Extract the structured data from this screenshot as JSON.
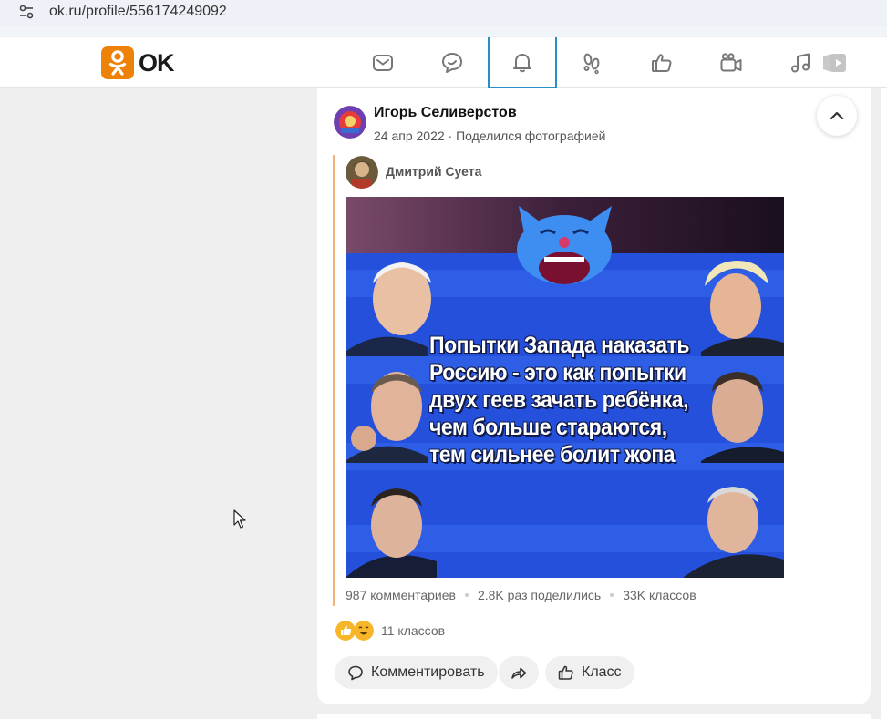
{
  "browser": {
    "url": "ok.ru/profile/556174249092",
    "site_icon": "site-settings-icon"
  },
  "header": {
    "logo_text": "OK",
    "brand_color": "#ee8208",
    "nav": [
      {
        "name": "messages",
        "icon": "envelope-icon"
      },
      {
        "name": "discussions",
        "icon": "chat-bubbles-icon"
      },
      {
        "name": "notifications",
        "icon": "bell-icon",
        "active": true
      },
      {
        "name": "guests",
        "icon": "footprints-icon"
      },
      {
        "name": "events",
        "icon": "thumbs-up-icon"
      },
      {
        "name": "video",
        "icon": "video-camera-icon"
      },
      {
        "name": "music",
        "icon": "music-note-icon"
      },
      {
        "name": "games",
        "icon": "play-icon"
      }
    ]
  },
  "post": {
    "author": "Игорь Селиверстов",
    "date": "24 апр 2022",
    "separator": "·",
    "action": "Поделился фотографией",
    "original_author": "Дмитрий Суета",
    "image_text": "Попытки Запада наказать Россию - это как попытки двух геев зачать ребёнка, чем больше стараются, тем сильнее болит жопа",
    "stats": {
      "comments": "987 комментариев",
      "shares": "2.8K раз поделились",
      "likes": "33K классов"
    },
    "reactions_count": "11 классов",
    "buttons": {
      "comment": "Комментировать",
      "like": "Класс"
    }
  }
}
